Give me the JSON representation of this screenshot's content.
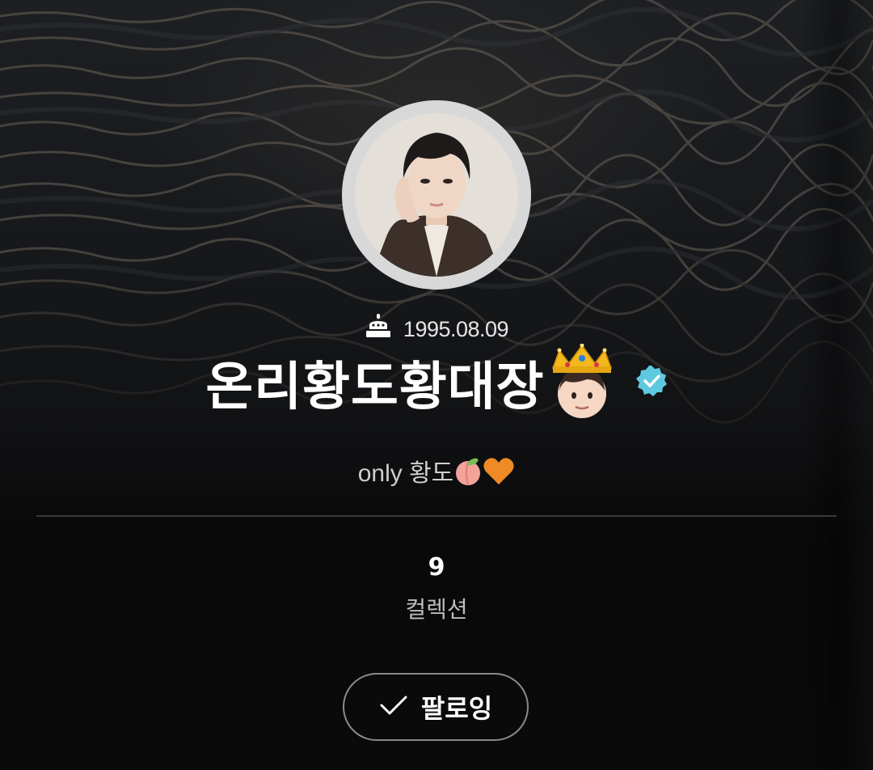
{
  "profile": {
    "birthday": "1995.08.09",
    "name": "온리황도황대장",
    "bio_text": "only 황도",
    "verified": true
  },
  "stats": {
    "collections_count": "9",
    "collections_label": "컬렉션"
  },
  "actions": {
    "follow_label": "팔로잉"
  },
  "icons": {
    "birthday": "cake-icon",
    "name_emoji": "crown-boy-emoji",
    "verified": "verified-badge-icon",
    "bio_emojis": [
      "peach-emoji",
      "orange-heart-emoji"
    ],
    "follow": "checkmark-icon"
  },
  "colors": {
    "verified_badge": "#5ec8e0",
    "background": "#111315",
    "follow_border": "#8a8a8a"
  }
}
